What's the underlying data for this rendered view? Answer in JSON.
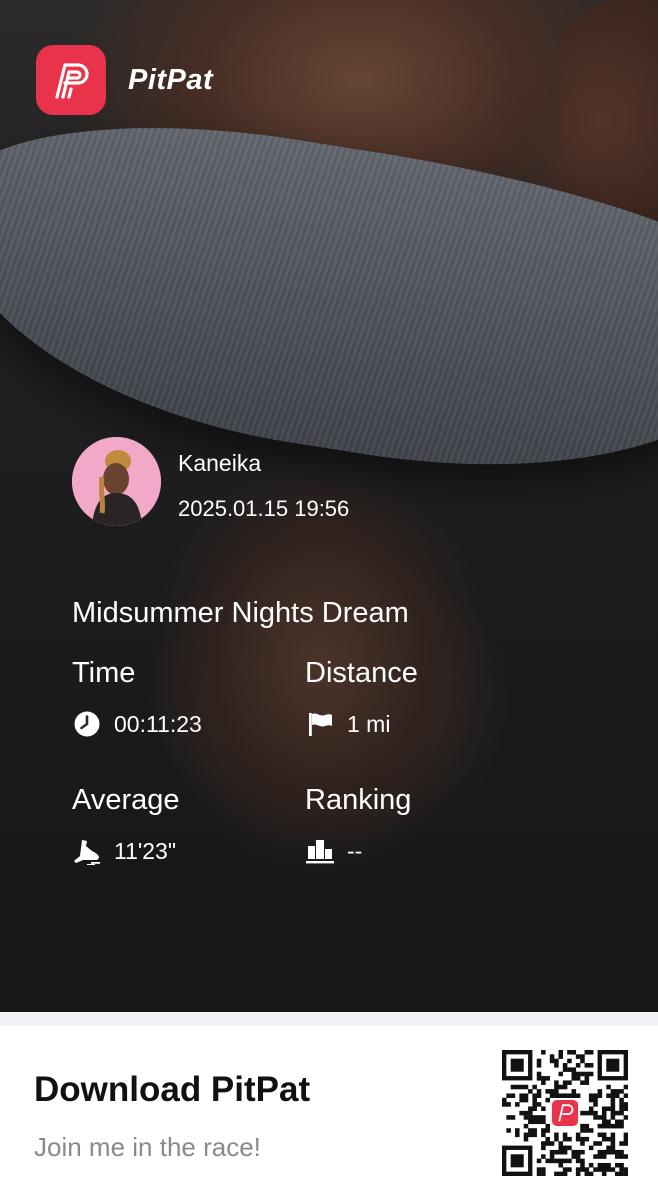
{
  "app": {
    "brand_name": "PitPat",
    "brand_color": "#e8334a"
  },
  "user": {
    "name": "Kaneika",
    "datetime": "2025.01.15 19:56"
  },
  "race": {
    "title": "Midsummer Nights Dream",
    "stats": [
      {
        "label": "Time",
        "value": "00:11:23",
        "icon": "clock-icon"
      },
      {
        "label": "Distance",
        "value": "1 mi",
        "icon": "flag-icon"
      },
      {
        "label": "Average",
        "value": "11'23\"",
        "icon": "shoe-icon"
      },
      {
        "label": "Ranking",
        "value": "--",
        "icon": "podium-icon"
      }
    ]
  },
  "footer": {
    "title": "Download PitPat",
    "subtitle": "Join me in the race!",
    "qr_icon": "qr-code-icon"
  }
}
